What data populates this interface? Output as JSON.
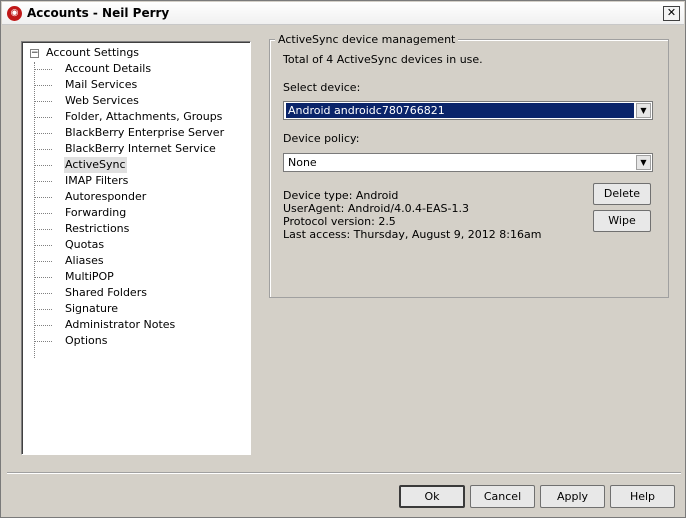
{
  "window": {
    "title": "Accounts - Neil Perry",
    "close_glyph": "✕"
  },
  "tree": {
    "root_label": "Account Settings",
    "expander_glyph": "−",
    "selected_index": 7,
    "items": [
      "Account Details",
      "Mail Services",
      "Web Services",
      "Folder, Attachments, Groups",
      "BlackBerry Enterprise Server",
      "BlackBerry Internet Service",
      "ActiveSync",
      "IMAP Filters",
      "Autoresponder",
      "Forwarding",
      "Restrictions",
      "Quotas",
      "Aliases",
      "MultiPOP",
      "Shared Folders",
      "Signature",
      "Administrator Notes",
      "Options"
    ]
  },
  "activesync": {
    "group_title": "ActiveSync device management",
    "total_text": "Total of 4 ActiveSync devices in use.",
    "select_device_label": "Select device:",
    "select_device_value": "Android androidc780766821",
    "device_policy_label": "Device policy:",
    "device_policy_value": "None",
    "device_type": "Device type: Android",
    "user_agent": "UserAgent: Android/4.0.4-EAS-1.3",
    "protocol_version": "Protocol version: 2.5",
    "last_access": "Last access: Thursday, August 9, 2012 8:16am",
    "delete_label": "Delete",
    "wipe_label": "Wipe"
  },
  "footer": {
    "ok_label": "Ok",
    "cancel_label": "Cancel",
    "apply_label": "Apply",
    "help_label": "Help"
  }
}
